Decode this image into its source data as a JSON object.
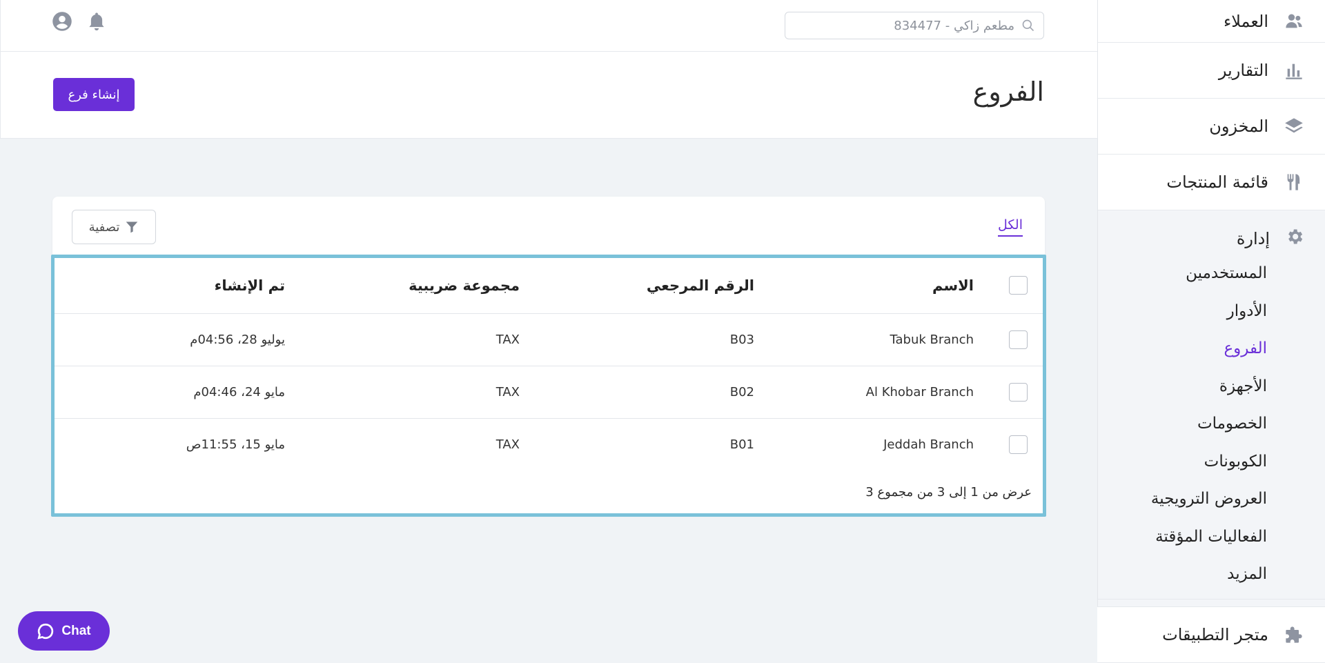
{
  "sidebar": {
    "top_items": [
      {
        "label": "العملاء",
        "icon": "customers-icon"
      },
      {
        "label": "التقارير",
        "icon": "bar-chart-icon"
      },
      {
        "label": "المخزون",
        "icon": "layers-icon"
      },
      {
        "label": "قائمة المنتجات",
        "icon": "utensils-icon"
      }
    ],
    "manage": {
      "label": "إدارة",
      "icon": "gear-icon",
      "items": [
        {
          "label": "المستخدمين",
          "active": false
        },
        {
          "label": "الأدوار",
          "active": false
        },
        {
          "label": "الفروع",
          "active": true
        },
        {
          "label": "الأجهزة",
          "active": false
        },
        {
          "label": "الخصومات",
          "active": false
        },
        {
          "label": "الكوبونات",
          "active": false
        },
        {
          "label": "العروض الترويجية",
          "active": false
        },
        {
          "label": "الفعاليات المؤقتة",
          "active": false
        },
        {
          "label": "المزيد",
          "active": false
        }
      ]
    },
    "app_store": {
      "label": "متجر التطبيقات",
      "icon": "puzzle-icon"
    }
  },
  "header": {
    "search_placeholder": "مطعم زاكي - 834477"
  },
  "page": {
    "title": "الفروع",
    "create_button": "إنشاء فرع"
  },
  "card": {
    "tab_all": "الكل",
    "filter_label": "تصفية",
    "columns": {
      "name": "الاسم",
      "reference": "الرقم المرجعي",
      "tax_group": "مجموعة ضريبية",
      "created": "تم الإنشاء"
    },
    "rows": [
      {
        "name": "Tabuk Branch",
        "reference": "B03",
        "tax_group": "TAX",
        "created": "يوليو 28، 04:56م"
      },
      {
        "name": "Al Khobar Branch",
        "reference": "B02",
        "tax_group": "TAX",
        "created": "مايو 24، 04:46م"
      },
      {
        "name": "Jeddah Branch",
        "reference": "B01",
        "tax_group": "TAX",
        "created": "مايو 15، 11:55ص"
      }
    ],
    "footer": "عرض من 1 إلى 3 من مجموع 3"
  },
  "chat": {
    "label": "Chat"
  },
  "colors": {
    "accent": "#6a2fd8",
    "highlight_border": "#7ac1d9"
  }
}
